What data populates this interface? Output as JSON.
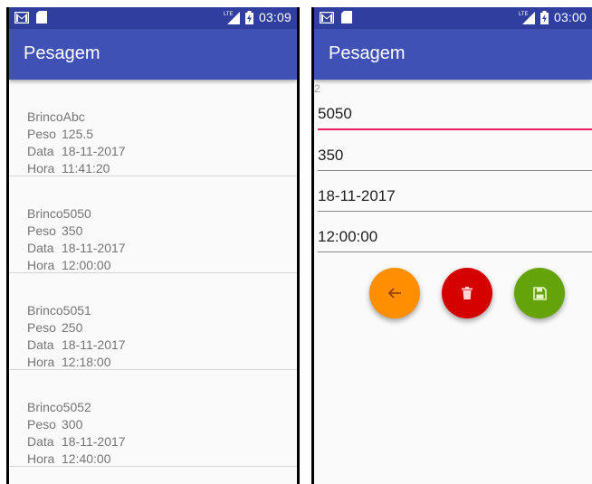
{
  "status_bar": {
    "time_left": "03:09",
    "time_right": "03:00",
    "network": "LTE"
  },
  "app": {
    "title": "Pesagem"
  },
  "labels": {
    "peso": "Peso",
    "data": "Data",
    "hora": "Hora"
  },
  "list": [
    {
      "brinco": "BrincoAbc",
      "peso": "125.5",
      "data": "18-11-2017",
      "hora": "11:41:20"
    },
    {
      "brinco": "Brinco5050",
      "peso": "350",
      "data": "18-11-2017",
      "hora": "12:00:00"
    },
    {
      "brinco": "Brinco5051",
      "peso": "250",
      "data": "18-11-2017",
      "hora": "12:18:00"
    },
    {
      "brinco": "Brinco5052",
      "peso": "300",
      "data": "18-11-2017",
      "hora": "12:40:00"
    }
  ],
  "form": {
    "id": "2",
    "brinco": "5050",
    "peso": "350",
    "data": "18-11-2017",
    "hora": "12:00:00"
  },
  "buttons": {
    "back": {
      "icon": "arrow-back-icon",
      "color": "#ff8f00"
    },
    "delete": {
      "icon": "trash-icon",
      "color": "#d50000"
    },
    "save": {
      "icon": "save-icon",
      "color": "#64a30a"
    }
  },
  "colors": {
    "primary": "#3f51b5",
    "primary_dark": "#303f9f",
    "accent": "#e91e63"
  }
}
